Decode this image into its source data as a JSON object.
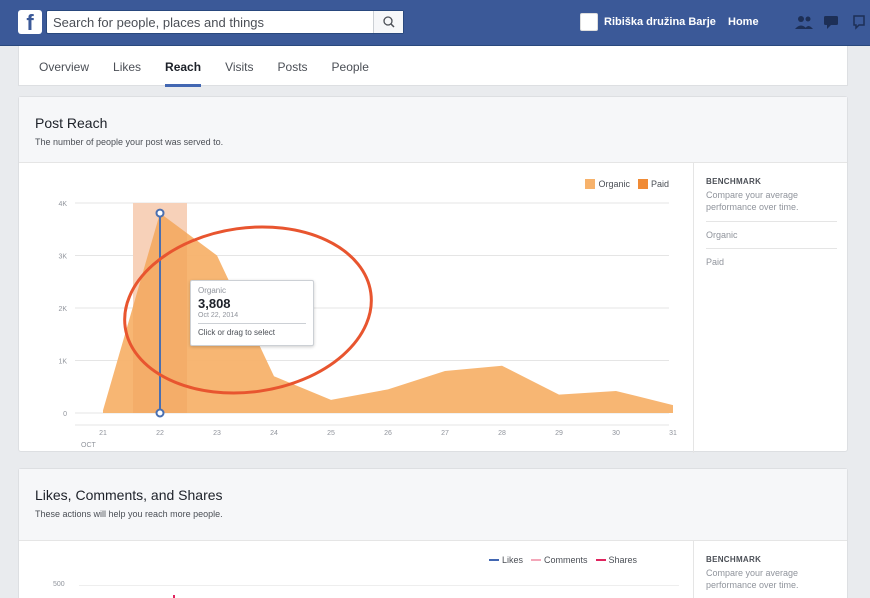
{
  "header": {
    "logo": "f",
    "search_placeholder": "Search for people, places and things",
    "page_name": "Ribiška družina Barje",
    "home": "Home",
    "icons": [
      "friend-requests-icon",
      "messages-icon",
      "notifications-icon"
    ],
    "bar_color": "#3b5998"
  },
  "tabs": [
    {
      "label": "Overview",
      "active": false
    },
    {
      "label": "Likes",
      "active": false
    },
    {
      "label": "Reach",
      "active": true
    },
    {
      "label": "Visits",
      "active": false
    },
    {
      "label": "Posts",
      "active": false
    },
    {
      "label": "People",
      "active": false
    }
  ],
  "post_reach": {
    "title": "Post Reach",
    "subtitle": "The number of people your post was served to.",
    "benchmark": {
      "title": "BENCHMARK",
      "desc": "Compare your average performance over time.",
      "items": [
        "Organic",
        "Paid"
      ]
    },
    "tooltip": {
      "label": "Organic",
      "value": "3,808",
      "date": "Oct 22, 2014",
      "hint": "Click or drag to select"
    }
  },
  "lcs": {
    "title": "Likes, Comments, and Shares",
    "subtitle": "These actions will help you reach more people.",
    "legend": [
      {
        "name": "Likes",
        "color": "#4267b2"
      },
      {
        "name": "Comments",
        "color": "#f4a7b9"
      },
      {
        "name": "Shares",
        "color": "#e0245e"
      }
    ],
    "benchmark": {
      "title": "BENCHMARK",
      "desc": "Compare your average performance over time."
    },
    "y_tick": "500"
  },
  "chart_data": {
    "type": "area",
    "x_prefix": "OCT",
    "categories": [
      "21",
      "22",
      "23",
      "24",
      "25",
      "26",
      "27",
      "28",
      "29",
      "30",
      "31"
    ],
    "series": [
      {
        "name": "Organic",
        "color": "#f7b26b",
        "values": [
          50,
          3808,
          3000,
          700,
          250,
          450,
          800,
          900,
          350,
          420,
          150
        ]
      },
      {
        "name": "Paid",
        "color": "#f08b36",
        "values": [
          0,
          0,
          0,
          0,
          0,
          0,
          0,
          0,
          0,
          0,
          0
        ]
      }
    ],
    "y_ticks": [
      "0",
      "1K",
      "2K",
      "3K",
      "4K"
    ],
    "ylim": [
      0,
      4000
    ],
    "selected_index": 1,
    "legend_position": "top-right"
  }
}
